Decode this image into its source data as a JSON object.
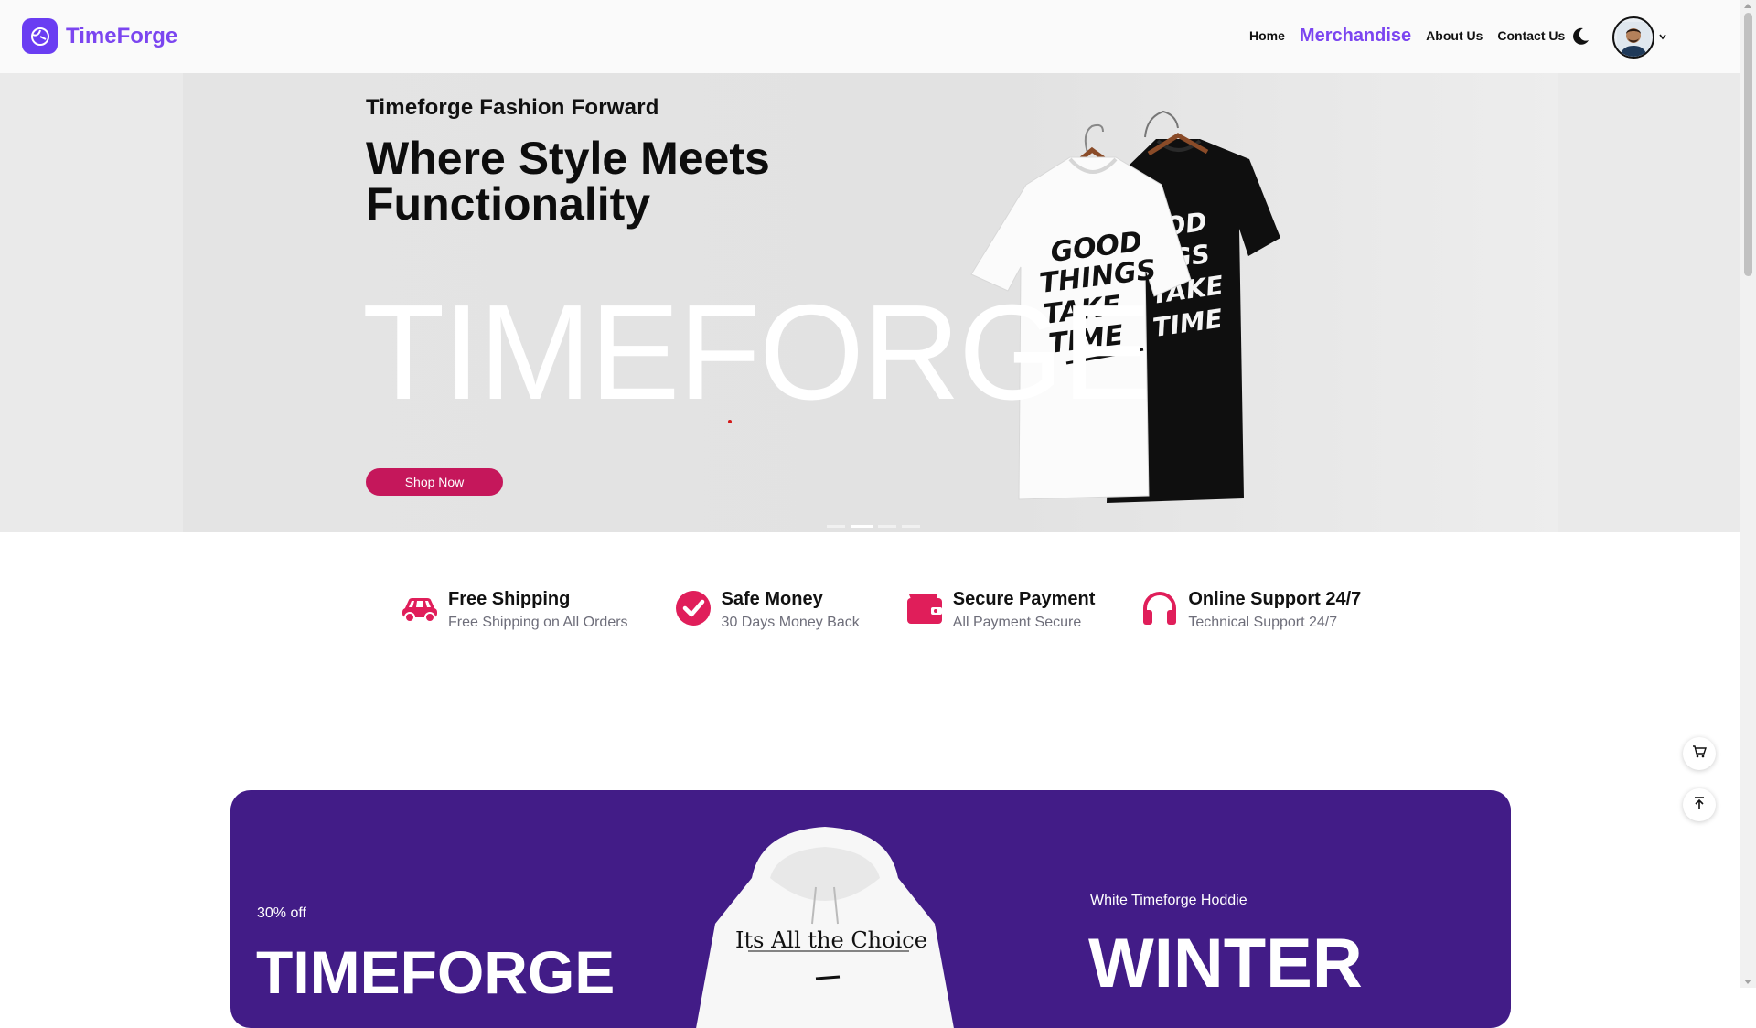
{
  "brand": {
    "name": "TimeForge",
    "accent": "#7b45f0"
  },
  "nav": {
    "items": [
      {
        "label": "Home",
        "active": false
      },
      {
        "label": "Merchandise",
        "active": true
      },
      {
        "label": "About Us",
        "active": false
      },
      {
        "label": "Contact Us",
        "active": false
      }
    ],
    "theme_toggle_icon": "moon-icon",
    "avatar_menu_icon": "chevron-down-icon"
  },
  "hero": {
    "subtitle": "Timeforge Fashion Forward",
    "title": "Where Style Meets Functionality",
    "watermark": "TIMEFORGE",
    "cta_label": "Shop Now",
    "cta_color": "#c5175b",
    "shirt_print": [
      "GOOD",
      "THINGS",
      "TAKE",
      "TIME"
    ],
    "slides": 4,
    "active_slide": 2
  },
  "features": [
    {
      "icon": "car-icon",
      "title": "Free Shipping",
      "desc": "Free Shipping on All Orders"
    },
    {
      "icon": "check-circle-icon",
      "title": "Safe Money",
      "desc": "30 Days Money Back"
    },
    {
      "icon": "wallet-icon",
      "title": "Secure Payment",
      "desc": "All Payment Secure"
    },
    {
      "icon": "headphones-icon",
      "title": "Online Support 24/7",
      "desc": "Technical Support 24/7"
    }
  ],
  "feature_icon_color": "#e01e5a",
  "floating": {
    "cart_icon": "cart-icon",
    "top_icon": "arrow-to-top-icon"
  },
  "promo": {
    "background": "#421c87",
    "discount": "30% off",
    "brand_word": "TIMEFORGE",
    "product_name": "White Timeforge Hoddie",
    "season": "WINTER",
    "hoodie_print": "Its All the Choice"
  }
}
